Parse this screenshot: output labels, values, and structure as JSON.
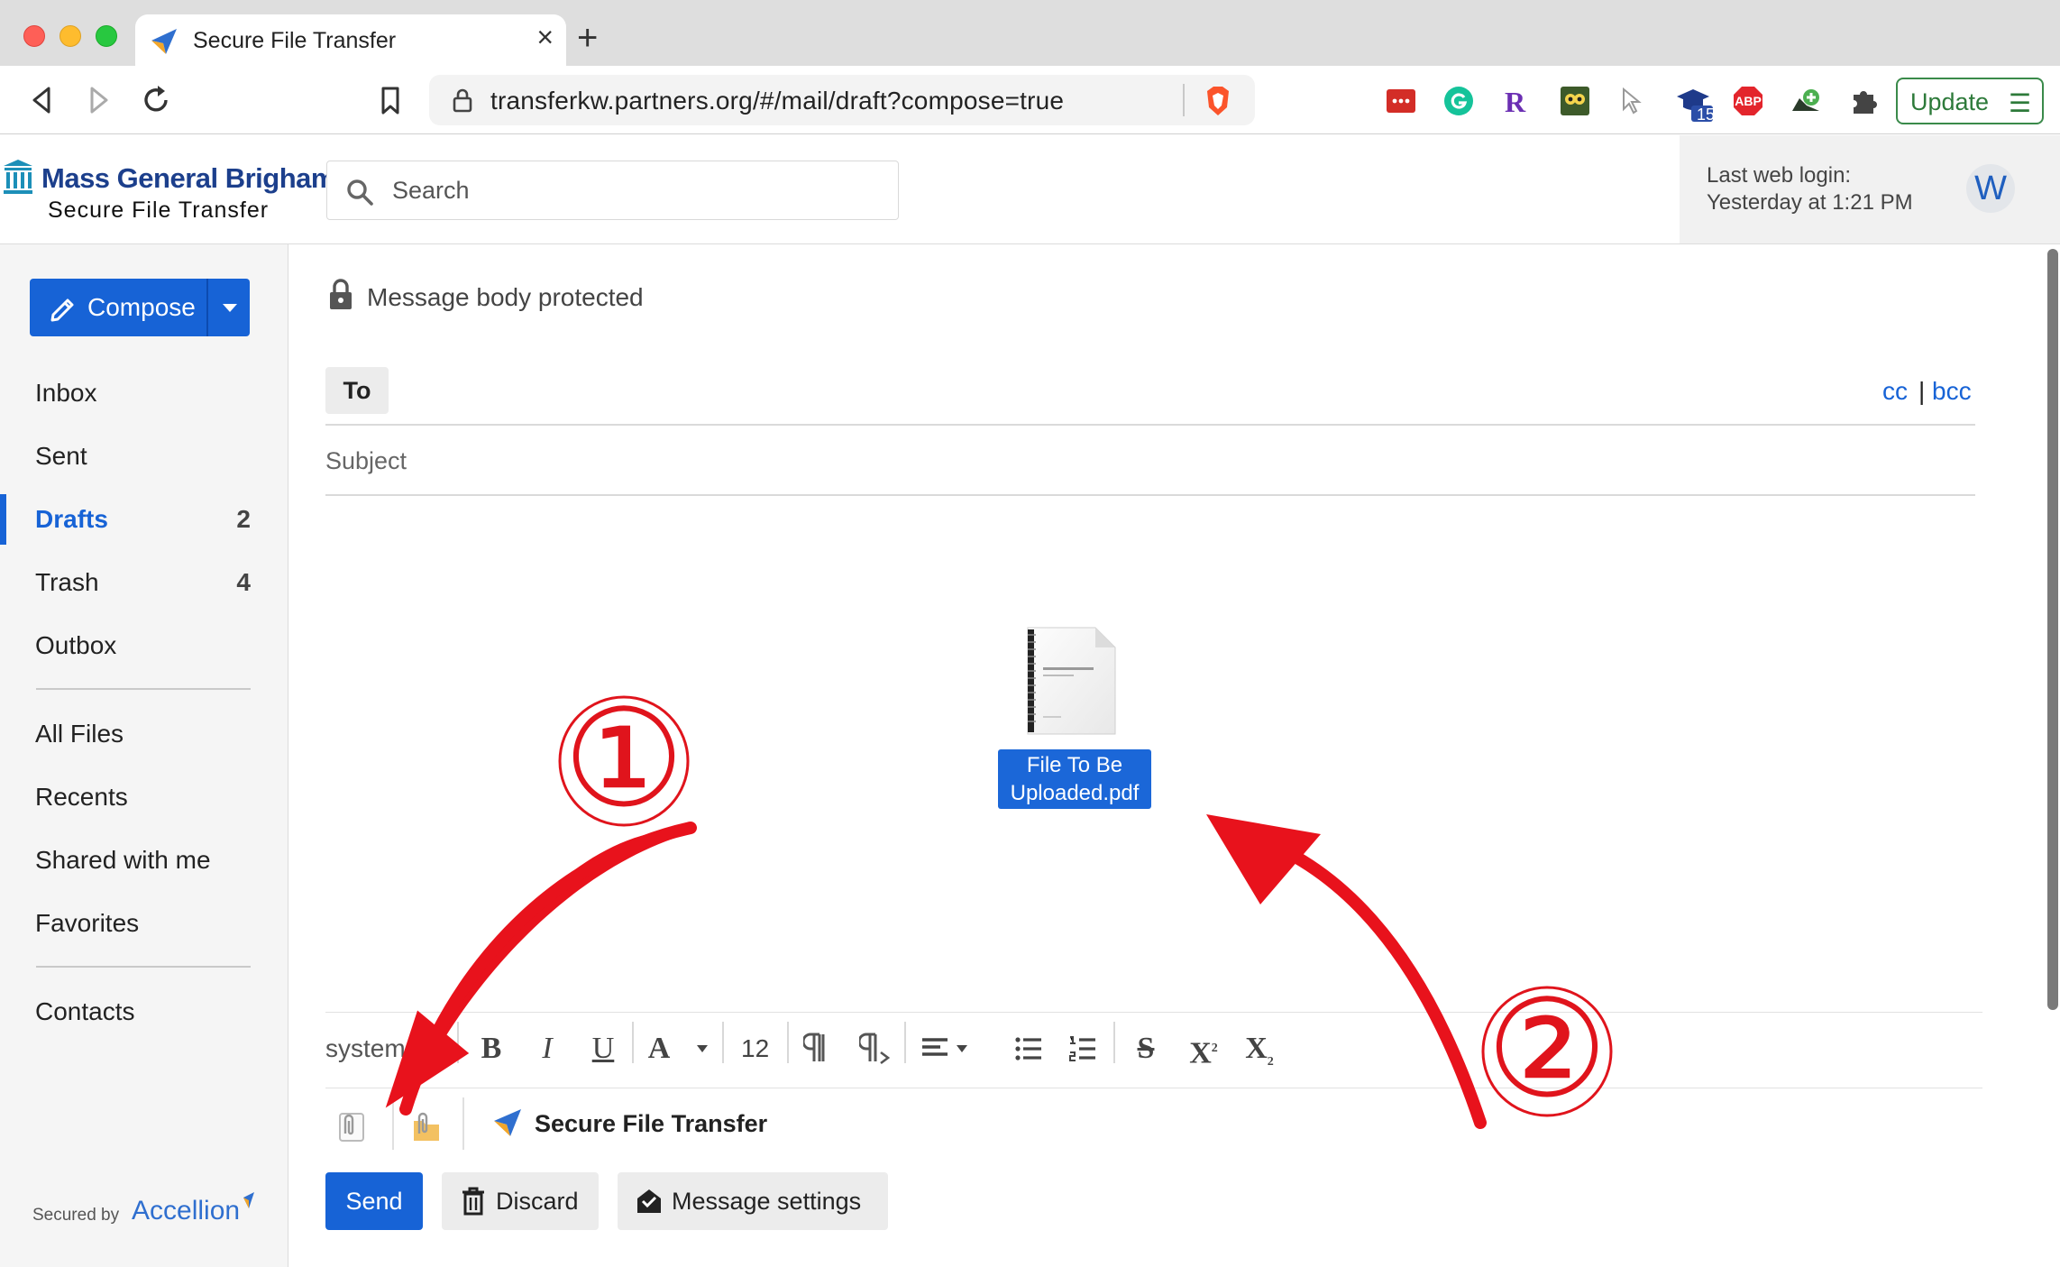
{
  "browser": {
    "tab_title": "Secure File Transfer",
    "tab_close": "×",
    "new_tab": "+",
    "url": "transferkw.partners.org/#/mail/draft?compose=true",
    "update_label": "Update",
    "update_menu": "☰",
    "extension_badge": "15",
    "adblock_label": "ABP",
    "ext_r_label": "R"
  },
  "header": {
    "brand": "Mass General Brigham",
    "product": "Secure File Transfer",
    "search_placeholder": "Search",
    "last_login_label": "Last web login:",
    "last_login_time": "Yesterday at 1:21 PM",
    "avatar_letter": "W"
  },
  "sidebar": {
    "compose_label": "Compose",
    "items": [
      {
        "label": "Inbox",
        "count": ""
      },
      {
        "label": "Sent",
        "count": ""
      },
      {
        "label": "Drafts",
        "count": "2"
      },
      {
        "label": "Trash",
        "count": "4"
      },
      {
        "label": "Outbox",
        "count": ""
      },
      {
        "label": "All Files",
        "count": ""
      },
      {
        "label": "Recents",
        "count": ""
      },
      {
        "label": "Shared with me",
        "count": ""
      },
      {
        "label": "Favorites",
        "count": ""
      },
      {
        "label": "Contacts",
        "count": ""
      }
    ],
    "secured_by": "Secured by",
    "secured_brand": "Accellion"
  },
  "compose": {
    "protected_text": "Message body protected",
    "to_label": "To",
    "cc_label": "cc",
    "cc_sep": "|",
    "bcc_label": "bcc",
    "subject_placeholder": "Subject",
    "file_name": "File To Be Uploaded.pdf",
    "font_name": "system",
    "font_size": "12",
    "sft_label": "Secure File Transfer",
    "send_label": "Send",
    "discard_label": "Discard",
    "settings_label": "Message settings"
  },
  "annotations": {
    "step1": "①",
    "step2": "②"
  },
  "colors": {
    "accent": "#1763d6",
    "annotation": "#e0141c",
    "brand": "#1c3f8c"
  }
}
